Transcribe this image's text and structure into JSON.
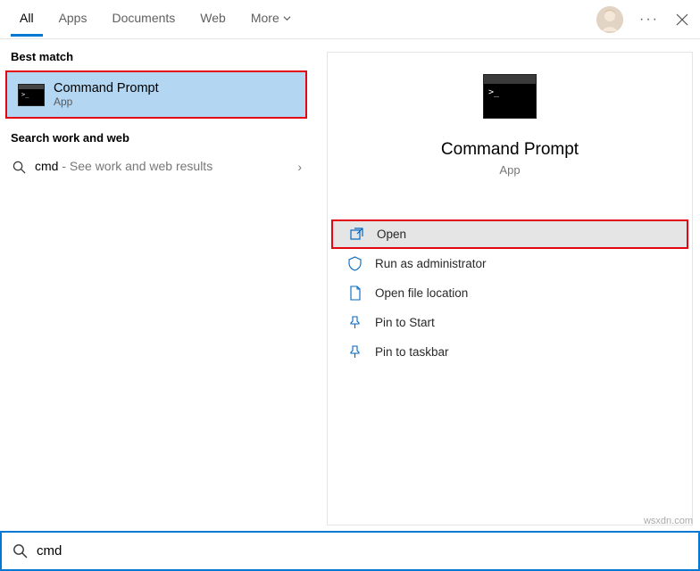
{
  "tabs": {
    "all": "All",
    "apps": "Apps",
    "documents": "Documents",
    "web": "Web",
    "more": "More"
  },
  "sections": {
    "best_match": "Best match",
    "search_work_web": "Search work and web"
  },
  "best_match": {
    "title": "Command Prompt",
    "subtitle": "App"
  },
  "web_search": {
    "term": "cmd",
    "hint": " - See work and web results"
  },
  "preview": {
    "title": "Command Prompt",
    "subtitle": "App"
  },
  "actions": {
    "open": "Open",
    "run_admin": "Run as administrator",
    "open_location": "Open file location",
    "pin_start": "Pin to Start",
    "pin_taskbar": "Pin to taskbar"
  },
  "search_input": {
    "value": "cmd"
  },
  "watermark": "wsxdn.com"
}
